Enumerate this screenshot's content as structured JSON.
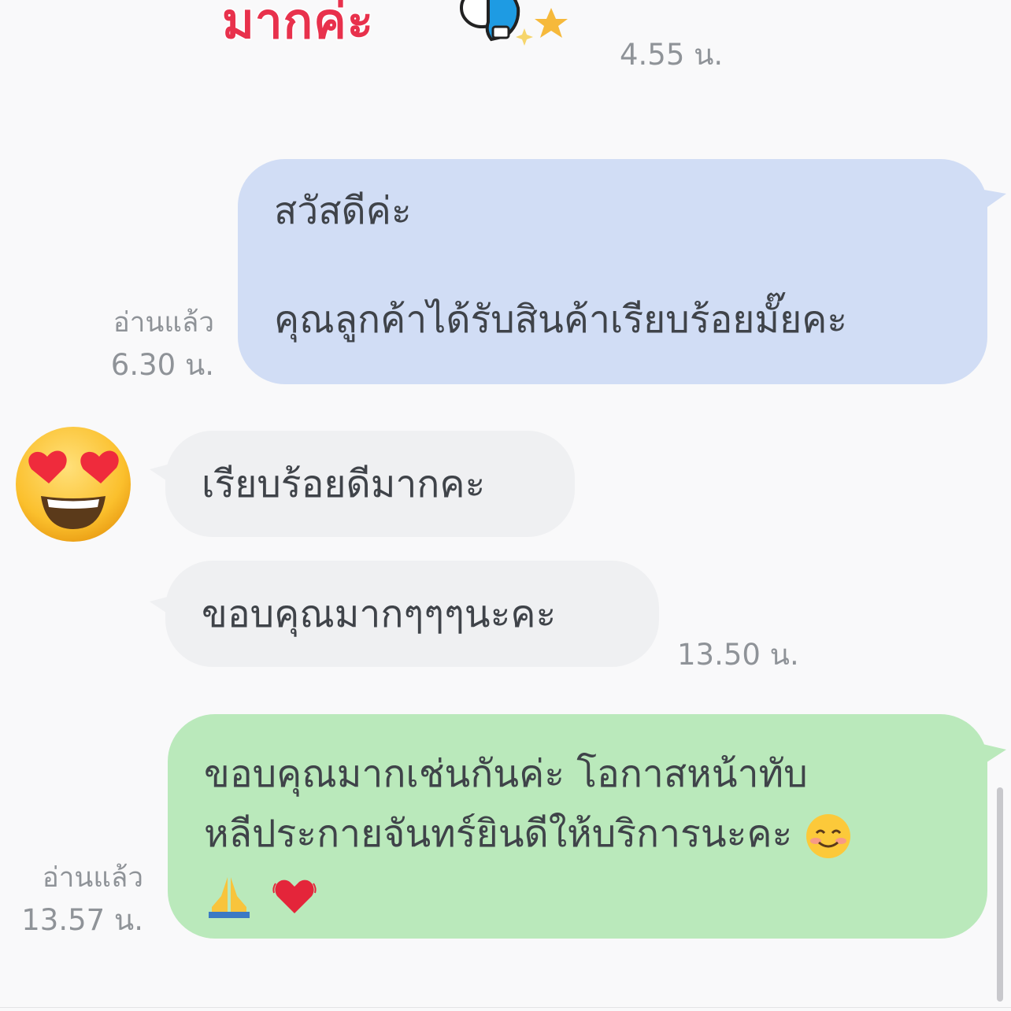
{
  "sticker": {
    "text": "มากค่ะ",
    "time": "4.55 น."
  },
  "messages": [
    {
      "id": "m1",
      "direction": "outgoing",
      "color": "#d1ddf5",
      "lines": [
        "สวัสดีค่ะ",
        "",
        "คุณลูกค้าได้รับสินค้าเรียบร้อยมั๊ยคะ"
      ],
      "read_label": "อ่านแล้ว",
      "time": "6.30 น."
    },
    {
      "id": "m2",
      "direction": "incoming",
      "color": "#eff0f2",
      "lines": [
        "เรียบร้อยดีมากคะ"
      ]
    },
    {
      "id": "m3",
      "direction": "incoming",
      "color": "#eff0f2",
      "lines": [
        "ขอบคุณมากๆๆๆนะคะ"
      ],
      "time": "13.50 น."
    },
    {
      "id": "m4",
      "direction": "outgoing",
      "color": "#bae9bb",
      "lines": [
        "ขอบคุณมากเช่นกันค่ะ โอกาสหน้าทับ",
        "หลีประกายจันทร์ยินดีให้บริการนะคะ"
      ],
      "emojis": [
        "smiling-face-emoji",
        "folded-hands-emoji",
        "beating-heart-emoji"
      ],
      "read_label": "อ่านแล้ว",
      "time": "13.57 น."
    }
  ],
  "avatar": {
    "icon": "heart-eyes-emoji"
  }
}
